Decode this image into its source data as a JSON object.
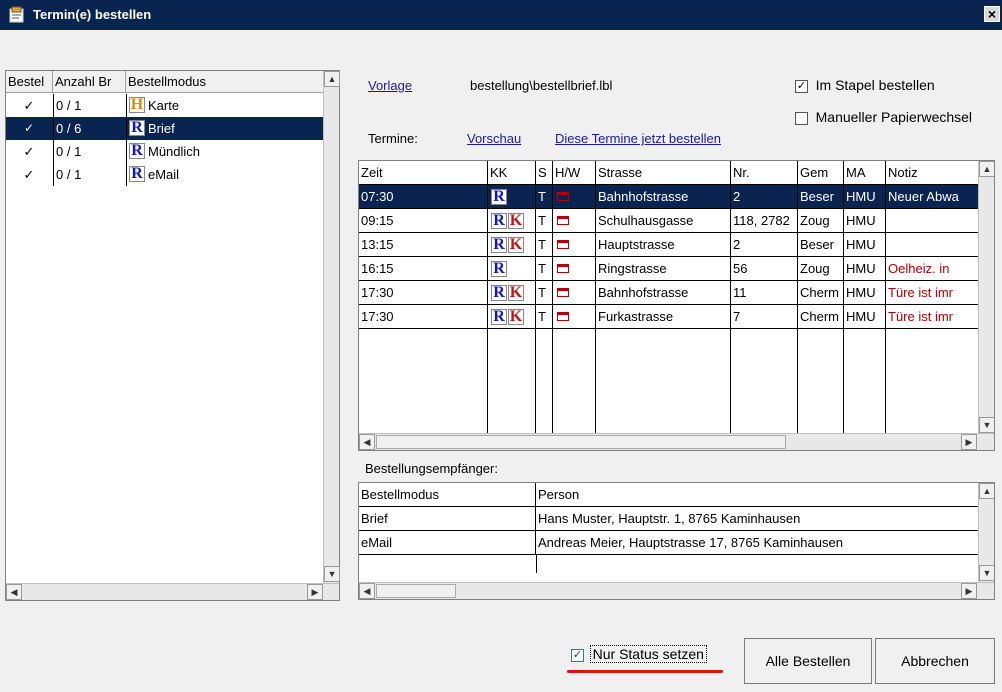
{
  "window": {
    "title": "Termin(e) bestellen",
    "close_glyph": "×"
  },
  "left_list": {
    "columns": [
      "Bestel",
      "Anzahl Br",
      "Bestellmodus"
    ],
    "rows": [
      {
        "check": "✓",
        "anzahl": "0 / 1",
        "badge": "H",
        "badge_color": "#e08a00",
        "modus": "Karte"
      },
      {
        "check": "✓",
        "anzahl": "0 / 6",
        "badge": "R",
        "badge_color": "#1016c8",
        "modus": "Brief"
      },
      {
        "check": "✓",
        "anzahl": "0 / 1",
        "badge": "R",
        "badge_color": "#1016c8",
        "modus": "Mündlich"
      },
      {
        "check": "✓",
        "anzahl": "0 / 1",
        "badge": "R",
        "badge_color": "#1016c8",
        "modus": "eMail"
      }
    ]
  },
  "vorlage": {
    "link": "Vorlage",
    "path": "bestellung\\bestellbrief.lbl"
  },
  "options": {
    "stapel": {
      "label": "Im Stapel bestellen",
      "checked": true
    },
    "papier": {
      "label": "Manueller Papierwechsel",
      "checked": false
    }
  },
  "termine": {
    "label": "Termine:",
    "preview_link": "Vorschau",
    "order_link": "Diese Termine jetzt bestellen",
    "columns": [
      "Zeit",
      "KK",
      "S",
      "H/W",
      "Strasse",
      "Nr.",
      "Gem",
      "MA",
      "Notiz"
    ],
    "rows": [
      {
        "zeit": "07:30",
        "kk": [
          "R"
        ],
        "s": "T",
        "strasse": "Bahnhofstrasse",
        "nr": "2",
        "gem": "Beser",
        "ma": "HMU",
        "notiz": "Neuer Abwa"
      },
      {
        "zeit": "09:15",
        "kk": [
          "R",
          "K"
        ],
        "s": "T",
        "strasse": "Schulhausgasse",
        "nr": "118, 2782",
        "gem": "Zoug",
        "ma": "HMU",
        "notiz": ""
      },
      {
        "zeit": "13:15",
        "kk": [
          "R",
          "K"
        ],
        "s": "T",
        "strasse": "Hauptstrasse",
        "nr": "2",
        "gem": "Beser",
        "ma": "HMU",
        "notiz": ""
      },
      {
        "zeit": "16:15",
        "kk": [
          "R"
        ],
        "s": "T",
        "strasse": "Ringstrasse",
        "nr": "56",
        "gem": "Zoug",
        "ma": "HMU",
        "notiz": "Oelheiz. in"
      },
      {
        "zeit": "17:30",
        "kk": [
          "R",
          "K"
        ],
        "s": "T",
        "strasse": "Bahnhofstrasse",
        "nr": "11",
        "gem": "Cherm",
        "ma": "HMU",
        "notiz": "Türe ist imr"
      },
      {
        "zeit": "17:30",
        "kk": [
          "R",
          "K"
        ],
        "s": "T",
        "strasse": "Furkastrasse",
        "nr": "7",
        "gem": "Cherm",
        "ma": "HMU",
        "notiz": "Türe ist imr"
      }
    ]
  },
  "empfaenger": {
    "label": "Bestellungsempfänger:",
    "columns": [
      "Bestellmodus",
      "Person"
    ],
    "rows": [
      {
        "modus": "Brief",
        "person": "Hans Muster, Hauptstr. 1, 8765 Kaminhausen"
      },
      {
        "modus": "eMail",
        "person": "Andreas Meier, Hauptstrasse 17, 8765 Kaminhausen"
      }
    ]
  },
  "footer": {
    "status_checkbox": {
      "label": "Nur Status setzen",
      "checked": true
    },
    "alle_button": "Alle Bestellen",
    "abbrechen_button": "Abbrechen",
    "accent_underline": "#e01010"
  }
}
